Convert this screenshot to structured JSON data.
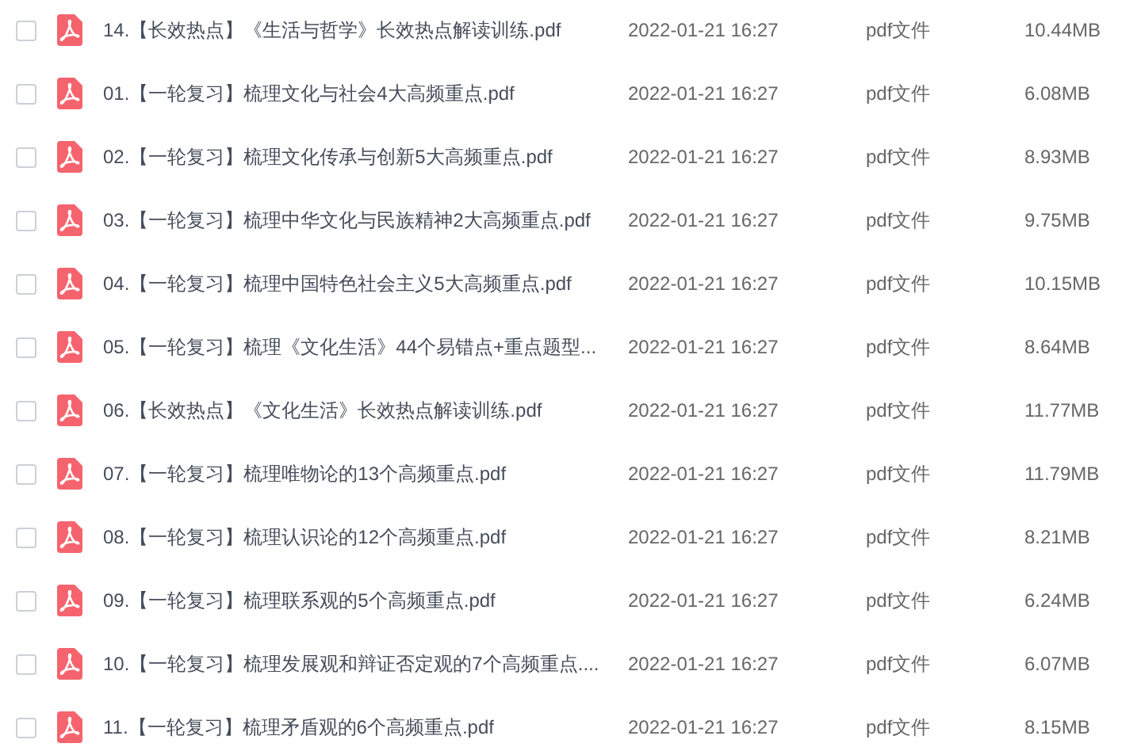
{
  "files": [
    {
      "checked": false,
      "name": "14.【长效热点】《生活与哲学》长效热点解读训练.pdf",
      "date": "2022-01-21 16:27",
      "type": "pdf文件",
      "size": "10.44MB"
    },
    {
      "checked": false,
      "name": "01.【一轮复习】梳理文化与社会4大高频重点.pdf",
      "date": "2022-01-21 16:27",
      "type": "pdf文件",
      "size": "6.08MB"
    },
    {
      "checked": false,
      "name": "02.【一轮复习】梳理文化传承与创新5大高频重点.pdf",
      "date": "2022-01-21 16:27",
      "type": "pdf文件",
      "size": "8.93MB"
    },
    {
      "checked": false,
      "name": "03.【一轮复习】梳理中华文化与民族精神2大高频重点.pdf",
      "date": "2022-01-21 16:27",
      "type": "pdf文件",
      "size": "9.75MB"
    },
    {
      "checked": false,
      "name": "04.【一轮复习】梳理中国特色社会主义5大高频重点.pdf",
      "date": "2022-01-21 16:27",
      "type": "pdf文件",
      "size": "10.15MB"
    },
    {
      "checked": false,
      "name": "05.【一轮复习】梳理《文化生活》44个易错点+重点题型...",
      "date": "2022-01-21 16:27",
      "type": "pdf文件",
      "size": "8.64MB"
    },
    {
      "checked": false,
      "name": "06.【长效热点】《文化生活》长效热点解读训练.pdf",
      "date": "2022-01-21 16:27",
      "type": "pdf文件",
      "size": "11.77MB"
    },
    {
      "checked": false,
      "name": "07.【一轮复习】梳理唯物论的13个高频重点.pdf",
      "date": "2022-01-21 16:27",
      "type": "pdf文件",
      "size": "11.79MB"
    },
    {
      "checked": false,
      "name": "08.【一轮复习】梳理认识论的12个高频重点.pdf",
      "date": "2022-01-21 16:27",
      "type": "pdf文件",
      "size": "8.21MB"
    },
    {
      "checked": false,
      "name": "09.【一轮复习】梳理联系观的5个高频重点.pdf",
      "date": "2022-01-21 16:27",
      "type": "pdf文件",
      "size": "6.24MB"
    },
    {
      "checked": false,
      "name": "10.【一轮复习】梳理发展观和辩证否定观的7个高频重点....",
      "date": "2022-01-21 16:27",
      "type": "pdf文件",
      "size": "6.07MB"
    },
    {
      "checked": false,
      "name": "11.【一轮复习】梳理矛盾观的6个高频重点.pdf",
      "date": "2022-01-21 16:27",
      "type": "pdf文件",
      "size": "8.15MB"
    }
  ]
}
